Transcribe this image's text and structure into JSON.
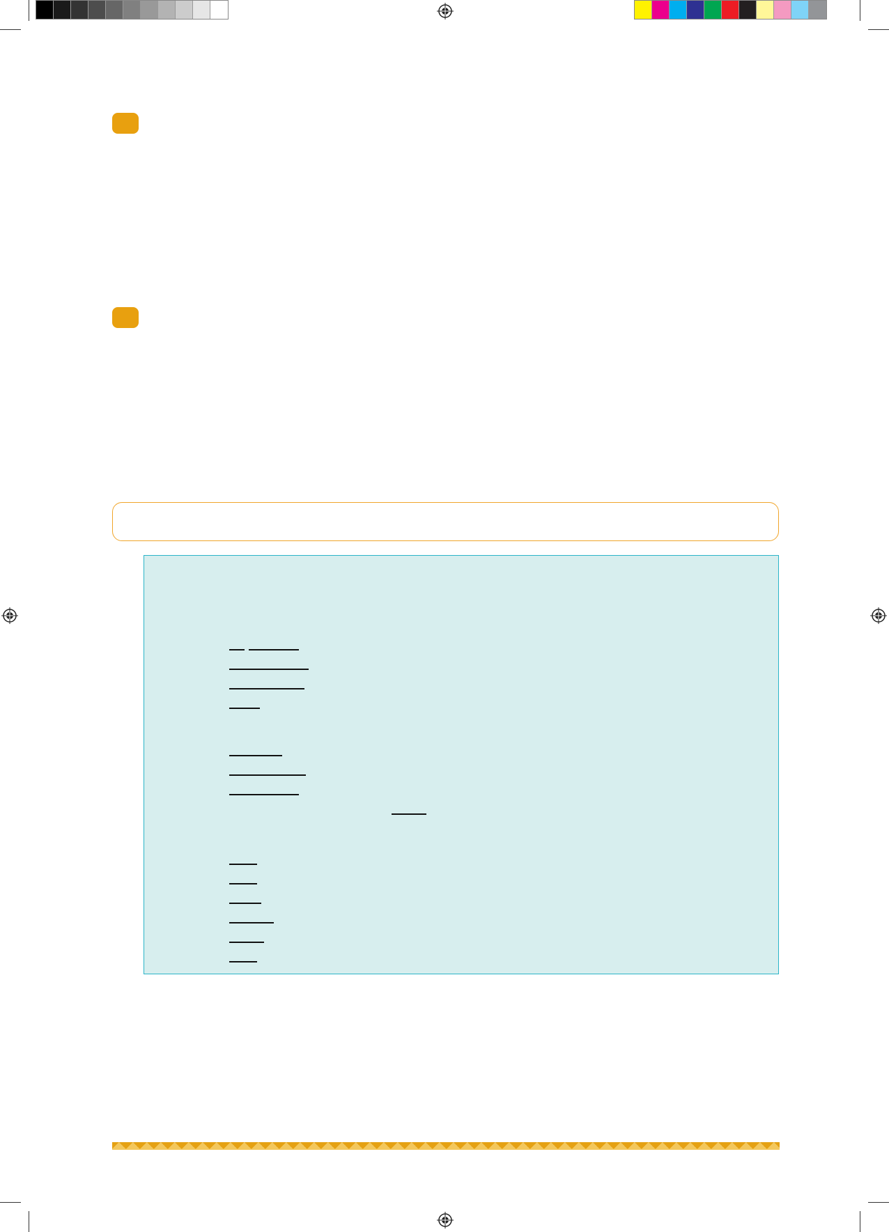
{
  "print_marks": {
    "gray_swatches": [
      "#000000",
      "#1a1a1a",
      "#333333",
      "#4d4d4d",
      "#666666",
      "#808080",
      "#999999",
      "#b3b3b3",
      "#cccccc",
      "#e6e6e6",
      "#ffffff"
    ],
    "color_swatches": [
      "#fff200",
      "#ec008c",
      "#00aeef",
      "#2e3192",
      "#00a651",
      "#ed1c24",
      "#231f20",
      "#fff799",
      "#f49ac1",
      "#7fd3f7",
      "#939598"
    ]
  },
  "colors": {
    "bullet": "#e8a00f",
    "header_border": "#f0a52a",
    "panel_background": "#d7eeee",
    "panel_border": "#2ab4c8",
    "zigzag": "#e5a113"
  },
  "icons": [
    "registration-mark-icon"
  ]
}
